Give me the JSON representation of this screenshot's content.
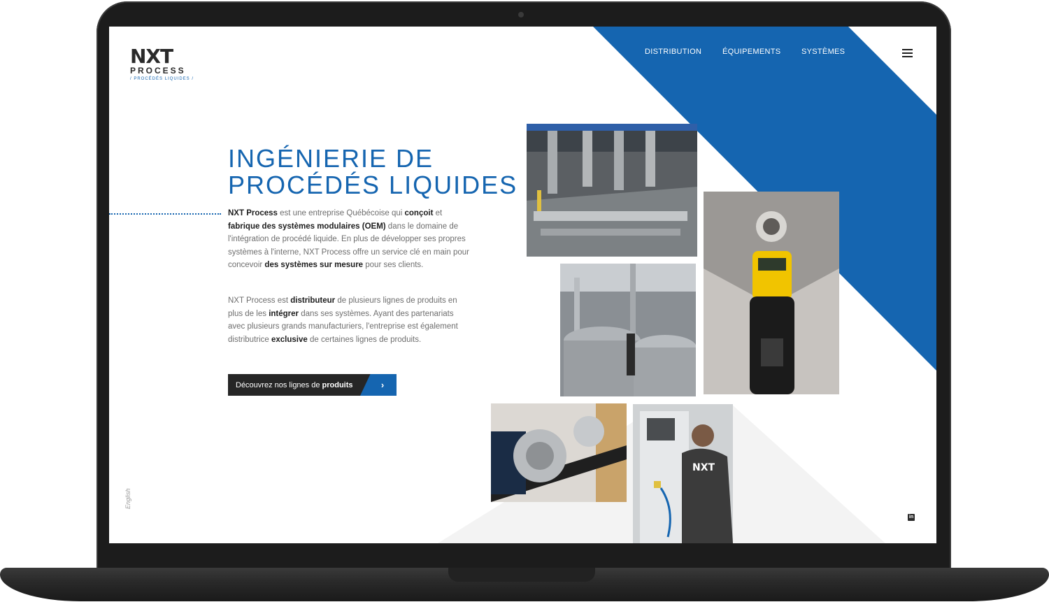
{
  "brand": {
    "mark": "NXT",
    "sub": "PROCESS",
    "tagline": "/ PROCÉDÉS LIQUIDES /"
  },
  "nav": {
    "items": [
      {
        "label": "DISTRIBUTION"
      },
      {
        "label": "ÉQUIPEMENTS"
      },
      {
        "label": "SYSTÈMES"
      }
    ],
    "menu_icon": "hamburger-icon"
  },
  "hero": {
    "title": "INGÉNIERIE DE\nPROCÉDÉS LIQUIDES",
    "paragraph1": [
      {
        "text": "NXT Process",
        "bold": true
      },
      {
        "text": " est une entreprise Québécoise qui ",
        "bold": false
      },
      {
        "text": "conçoit",
        "bold": true
      },
      {
        "text": " et ",
        "bold": false
      },
      {
        "text": "fabrique des systèmes modulaires (OEM)",
        "bold": true
      },
      {
        "text": " dans le domaine de l'intégration de procédé liquide. En plus de développer ses propres systèmes à l'interne, NXT Process offre un service clé en main pour concevoir ",
        "bold": false
      },
      {
        "text": "des systèmes sur mesure",
        "bold": true
      },
      {
        "text": " pour ses clients.",
        "bold": false
      }
    ],
    "paragraph2": [
      {
        "text": "NXT Process est ",
        "bold": false
      },
      {
        "text": "distributeur",
        "bold": true
      },
      {
        "text": " de plusieurs lignes de produits en plus de les ",
        "bold": false
      },
      {
        "text": "intégrer",
        "bold": true
      },
      {
        "text": " dans ses systèmes. Ayant des partenariats avec plusieurs grands manufacturiers, l'entreprise est également distributrice ",
        "bold": false
      },
      {
        "text": "exclusive",
        "bold": true
      },
      {
        "text": " de certaines lignes de produits.",
        "bold": false
      }
    ],
    "cta": {
      "label_prefix": "Découvrez nos lignes de ",
      "label_bold": "produits",
      "arrow": "›"
    }
  },
  "footer": {
    "language_link": "English",
    "social_icon": "linkedin-icon",
    "social_label": "in"
  },
  "colors": {
    "accent": "#1565b0",
    "dark": "#262626",
    "text": "#6e6e6e"
  }
}
